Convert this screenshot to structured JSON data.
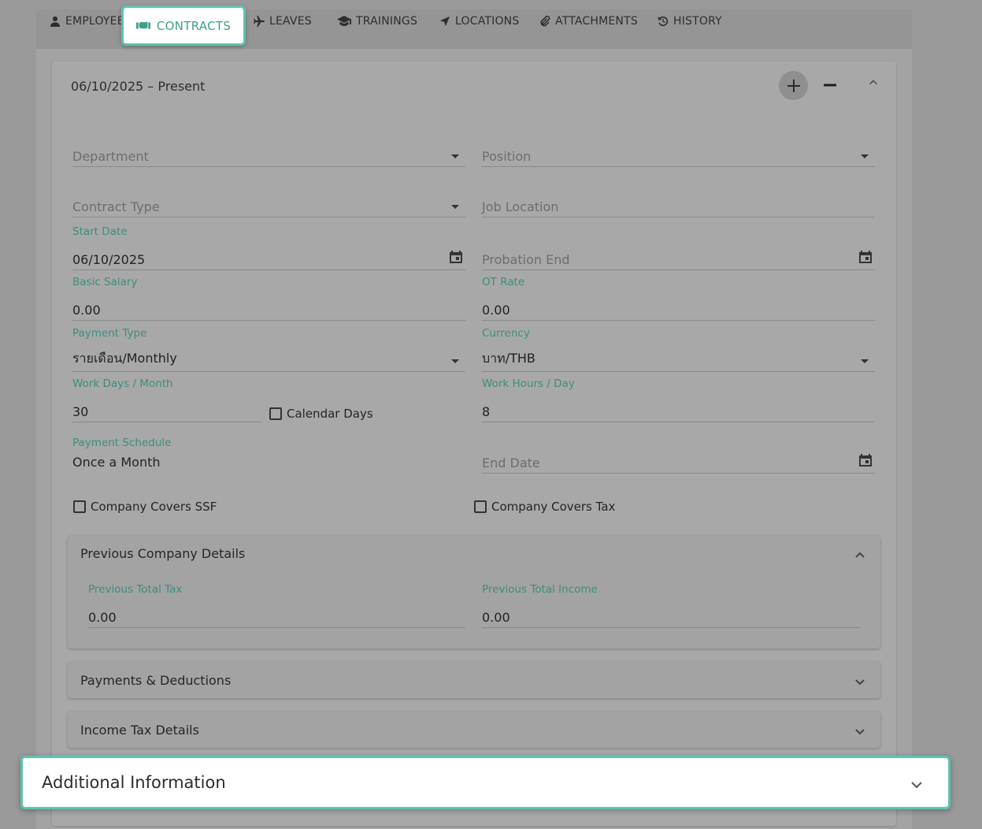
{
  "tabs": {
    "employee": "EMPLOYEE",
    "contracts": "CONTRACTS",
    "leaves": "LEAVES",
    "trainings": "TRAININGS",
    "locations": "LOCATIONS",
    "attachments": "ATTACHMENTS",
    "history": "HISTORY",
    "active": "contracts"
  },
  "contract": {
    "period": "06/10/2025 – Present",
    "fields": {
      "department": {
        "placeholder": "Department",
        "value": ""
      },
      "position": {
        "placeholder": "Position",
        "value": ""
      },
      "contract_type": {
        "placeholder": "Contract Type",
        "value": ""
      },
      "job_location": {
        "placeholder": "Job Location",
        "value": ""
      },
      "start_date": {
        "label": "Start Date",
        "value": "06/10/2025"
      },
      "probation_end": {
        "placeholder": "Probation End",
        "value": ""
      },
      "basic_salary": {
        "label": "Basic Salary",
        "value": "0.00"
      },
      "ot_rate": {
        "label": "OT Rate",
        "value": "0.00"
      },
      "payment_type": {
        "label": "Payment Type",
        "value": "รายเดือน/Monthly"
      },
      "currency": {
        "label": "Currency",
        "value": "บาท/THB"
      },
      "work_days_month": {
        "label": "Work Days / Month",
        "value": "30"
      },
      "calendar_days": {
        "label": "Calendar Days",
        "checked": false
      },
      "work_hours_day": {
        "label": "Work Hours / Day",
        "value": "8"
      },
      "payment_schedule": {
        "label": "Payment Schedule",
        "value": "Once a Month"
      },
      "end_date": {
        "placeholder": "End Date",
        "value": ""
      },
      "company_covers_ssf": {
        "label": "Company Covers SSF",
        "checked": false
      },
      "company_covers_tax": {
        "label": "Company Covers Tax",
        "checked": false
      }
    },
    "sections": {
      "previous_company": {
        "title": "Previous Company Details",
        "expanded": true,
        "previous_total_tax": {
          "label": "Previous Total Tax",
          "value": "0.00"
        },
        "previous_total_income": {
          "label": "Previous Total Income",
          "value": "0.00"
        }
      },
      "payments_deductions": {
        "title": "Payments & Deductions",
        "expanded": false
      },
      "income_tax": {
        "title": "Income Tax Details",
        "expanded": false
      },
      "additional_info": {
        "title": "Additional Information",
        "expanded": false
      }
    }
  },
  "colors": {
    "accent": "#5cc4b0",
    "label": "#3b8f7e",
    "overlay": "#9a9a9a"
  }
}
